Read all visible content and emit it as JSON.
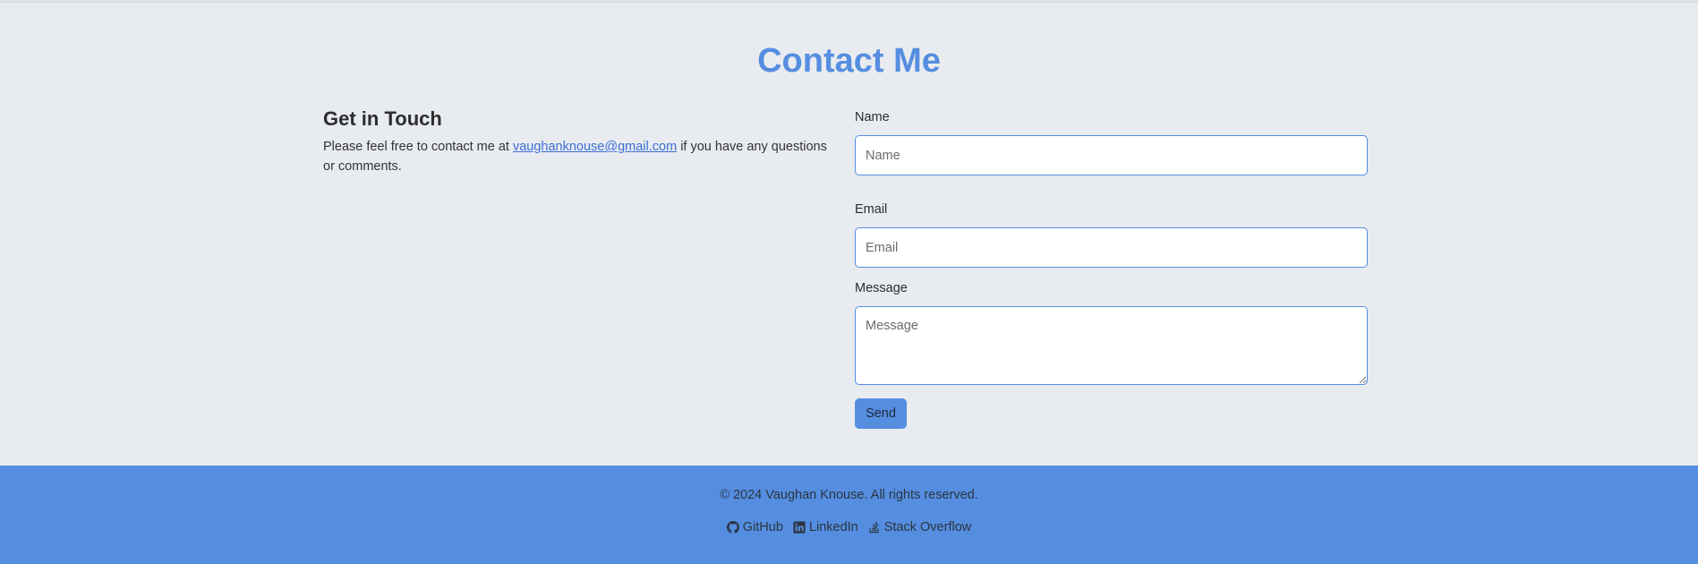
{
  "contact": {
    "title": "Contact Me",
    "intro": {
      "heading": "Get in Touch",
      "text_before": "Please feel free to contact me at ",
      "email_link": "vaughanknouse@gmail.com",
      "text_after": " if you have any questions or comments."
    },
    "form": {
      "name_label": "Name",
      "name_placeholder": "Name",
      "name_value": "",
      "email_label": "Email",
      "email_placeholder": "Email",
      "email_value": "",
      "message_label": "Message",
      "message_placeholder": "Message",
      "message_value": "",
      "send_label": "Send"
    }
  },
  "footer": {
    "copyright": "© 2024 Vaughan Knouse. All rights reserved.",
    "links": [
      {
        "label": "GitHub",
        "icon": "github-icon"
      },
      {
        "label": "LinkedIn",
        "icon": "linkedin-icon"
      },
      {
        "label": "Stack Overflow",
        "icon": "stack-overflow-icon"
      }
    ]
  },
  "colors": {
    "accent": "#558ee0",
    "background": "#e8ebef",
    "link": "#3b6fd8",
    "text": "#2c2c2c"
  }
}
